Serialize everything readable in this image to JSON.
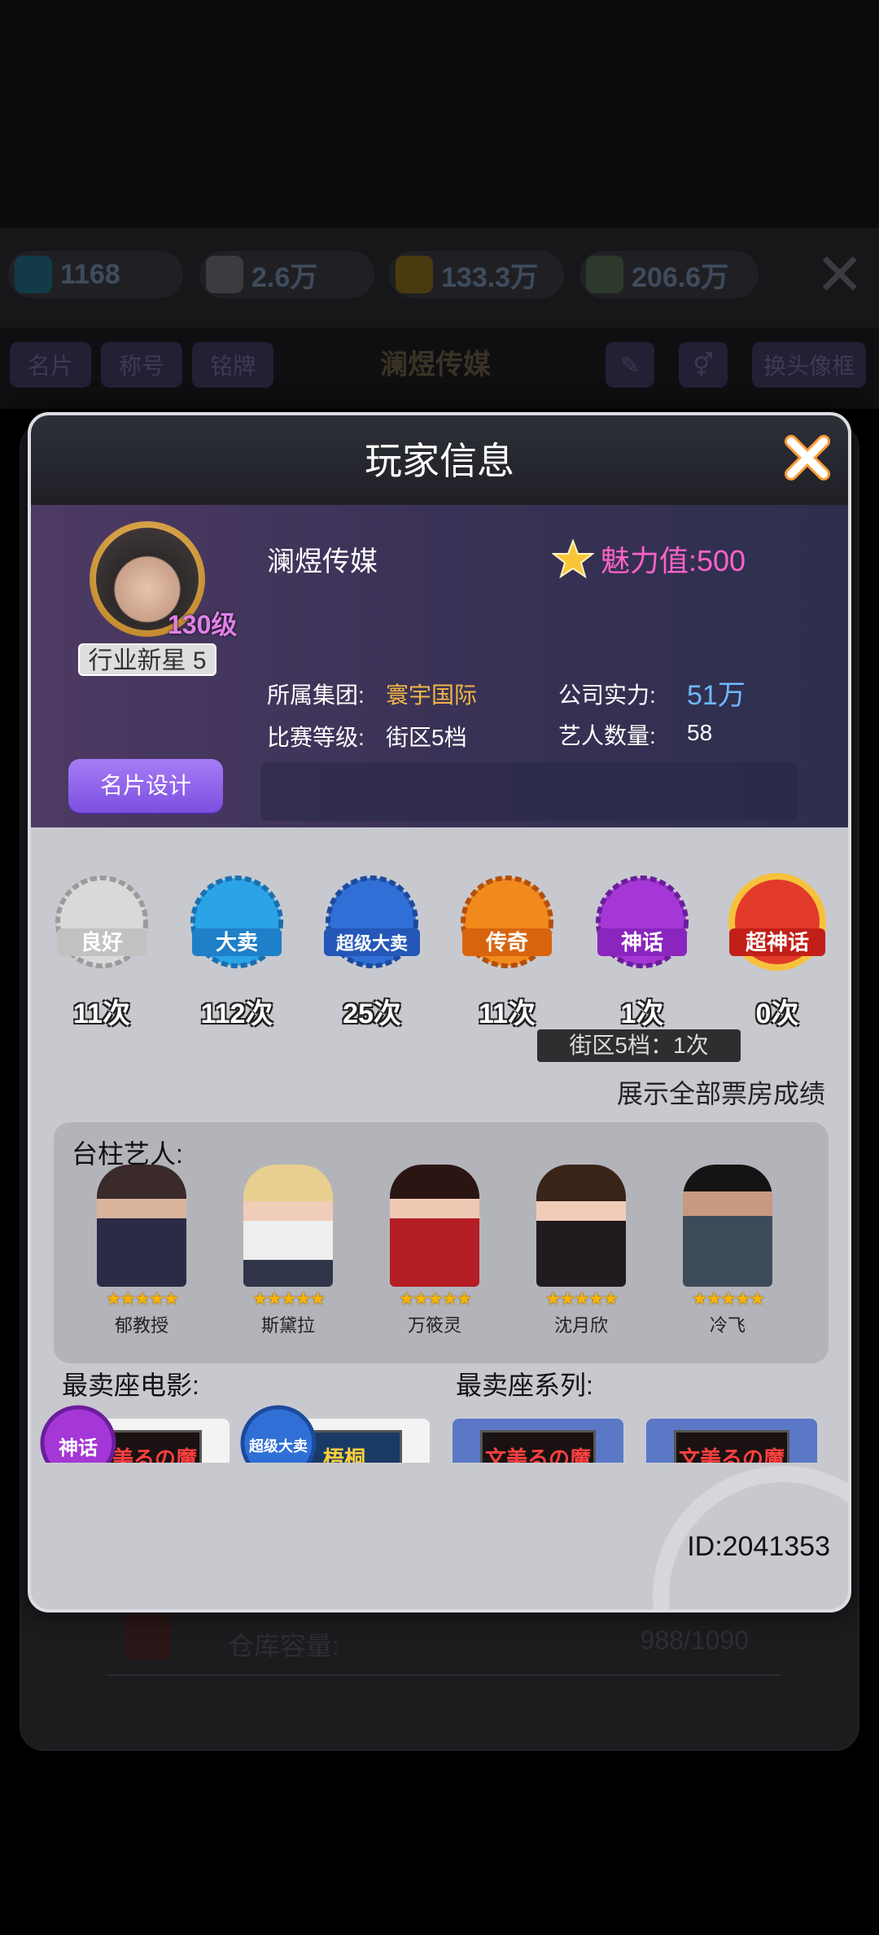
{
  "background": {
    "resources": [
      {
        "icon": "diamond-icon",
        "value": "1168"
      },
      {
        "icon": "thumbs-up-icon",
        "value": "2.6万"
      },
      {
        "icon": "gold-coins-icon",
        "value": "133.3万"
      },
      {
        "icon": "cash-icon",
        "value": "206.6万"
      }
    ],
    "tabs": [
      "名片",
      "称号",
      "铭牌"
    ],
    "company_name": "澜煜传媒",
    "change_frame_label": "换头像框",
    "warehouse_label": "仓库容量:",
    "warehouse_value": "988/1090"
  },
  "dialog": {
    "title": "玩家信息",
    "profile": {
      "level": "130级",
      "rank_title": "行业新星 5",
      "name": "澜煜传媒",
      "charm": "魅力值:500",
      "group_label": "所属集团:",
      "group_value": "寰宇国际",
      "strength_label": "公司实力:",
      "strength_value": "51万",
      "match_label": "比赛等级:",
      "match_value": "街区5档",
      "artists_label": "艺人数量:",
      "artists_value": "58",
      "design_button": "名片设计"
    },
    "badges": [
      {
        "label": "良好",
        "count": "11次",
        "color": "#d9d9d9"
      },
      {
        "label": "大卖",
        "count": "112次",
        "color": "#2aa4e6"
      },
      {
        "label": "超级大卖",
        "count": "25次",
        "color": "#2f6fd6"
      },
      {
        "label": "传奇",
        "count": "11次",
        "color": "#f08a1c"
      },
      {
        "label": "神话",
        "count": "1次",
        "color": "#a437d6"
      },
      {
        "label": "超神话",
        "count": "0次",
        "color": "#e23a2a"
      }
    ],
    "tooltip": "街区5档：1次",
    "show_all": "展示全部票房成绩",
    "stars_title": "台柱艺人:",
    "artists": [
      {
        "name": "郁教授",
        "stars": "★★★★★",
        "color": "#2c2b45"
      },
      {
        "name": "斯黛拉",
        "stars": "★★★★★",
        "color": "#e8d4b8"
      },
      {
        "name": "万筱灵",
        "stars": "★★★★★",
        "color": "#b51d24"
      },
      {
        "name": "沈月欣",
        "stars": "★★★★★",
        "color": "#1f1b1e"
      },
      {
        "name": "冷飞",
        "stars": "★★★★★",
        "color": "#3c4a5a"
      }
    ],
    "best_movie_title": "最卖座电影:",
    "best_series_title": "最卖座系列:",
    "posters": [
      {
        "text": "文美るの魔",
        "badge": "神话"
      },
      {
        "text": "梧桐",
        "badge": "超级大卖"
      },
      {
        "text": "文美るの魔",
        "badge": ""
      },
      {
        "text": "文美るの魔",
        "badge": ""
      }
    ],
    "player_id": "ID:2041353"
  }
}
